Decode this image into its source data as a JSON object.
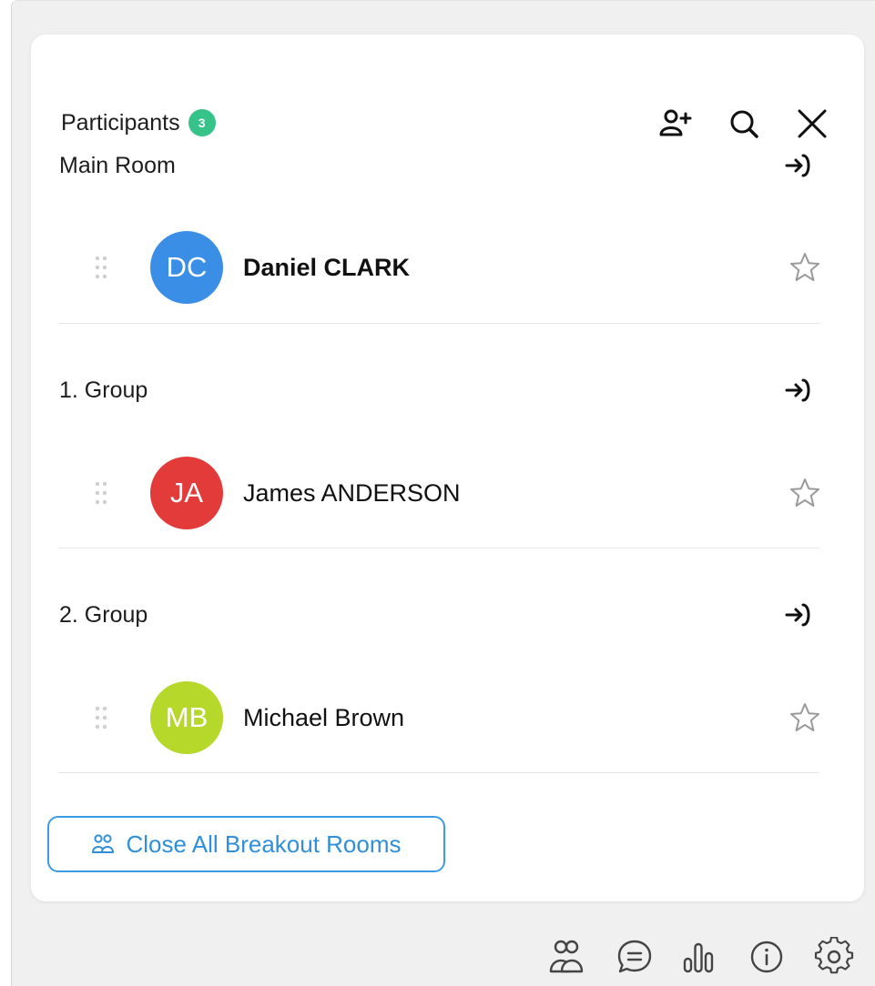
{
  "panel": {
    "title": "Participants",
    "count": "3",
    "badge_color": "#36c389"
  },
  "header_icons": [
    "add-user-icon",
    "search-icon",
    "close-icon"
  ],
  "rooms": [
    {
      "name": "Main Room",
      "participants": [
        {
          "initials": "DC",
          "name": "Daniel CLARK",
          "avatar_color": "#3a8ee6",
          "bold": true
        }
      ]
    },
    {
      "name": "1. Group",
      "participants": [
        {
          "initials": "JA",
          "name": "James ANDERSON",
          "avatar_color": "#e33a3a",
          "bold": false
        }
      ]
    },
    {
      "name": "2. Group",
      "participants": [
        {
          "initials": "MB",
          "name": "Michael Brown",
          "avatar_color": "#b5d82a",
          "bold": false
        }
      ]
    }
  ],
  "close_all_button": {
    "label": "Close All Breakout Rooms",
    "color": "#2f8fd9"
  },
  "bottom_bar_icons": [
    "participants-icon",
    "chat-icon",
    "poll-icon",
    "info-icon",
    "settings-icon"
  ]
}
